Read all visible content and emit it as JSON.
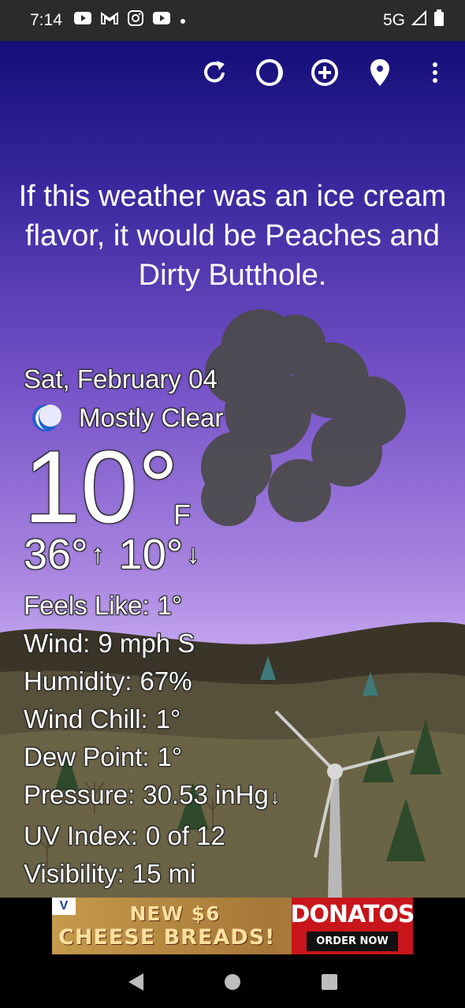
{
  "status_bar": {
    "time": "7:14",
    "notification_icons": [
      "youtube-icon",
      "gmail-icon",
      "instagram-icon",
      "youtube-icon",
      "dot-icon"
    ],
    "network": "5G",
    "signal_icon": "signal-icon",
    "battery_icon": "battery-icon"
  },
  "toolbar": {
    "icons": [
      "refresh-icon",
      "theme-icon",
      "add-location-icon",
      "location-pin-icon",
      "more-vert-icon"
    ]
  },
  "quote": "If this weather was an ice cream flavor, it would be Peaches and Dirty Butthole.",
  "weather": {
    "date": "Sat, February 04",
    "condition": "Mostly Clear",
    "condition_icon": "moon-icon",
    "temperature": "10°",
    "unit": "F",
    "high": "36°",
    "low": "10°"
  },
  "details": [
    {
      "label": "Feels Like:",
      "value": "1°"
    },
    {
      "label": "Wind:",
      "value": "9 mph S"
    },
    {
      "label": "Humidity:",
      "value": "67%"
    },
    {
      "label": "Wind Chill:",
      "value": "1°"
    },
    {
      "label": "Dew Point:",
      "value": "1°"
    },
    {
      "label": "Pressure:",
      "value": "30.53 inHg"
    },
    {
      "label": "UV Index:",
      "value": "0 of 12"
    },
    {
      "label": "Visibility:",
      "value": "15 mi"
    }
  ],
  "ad": {
    "line1": "NEW $6",
    "line2": "CHEESE BREADS!",
    "brand": "DONATOS",
    "cta": "ORDER NOW",
    "logo": "V"
  },
  "colors": {
    "sky_top": "#140d78",
    "sky_bottom": "#c9aee8",
    "ad_red": "#c8151b"
  }
}
